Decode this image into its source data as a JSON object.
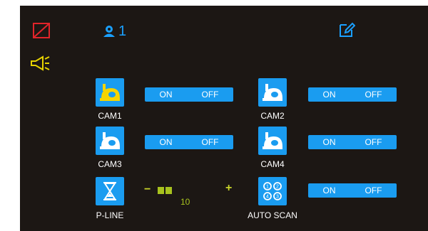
{
  "top": {
    "user_count": "1"
  },
  "cameras": [
    {
      "label": "CAM1",
      "on": "ON",
      "off": "OFF",
      "highlight": true
    },
    {
      "label": "CAM2",
      "on": "ON",
      "off": "OFF",
      "highlight": false
    },
    {
      "label": "CAM3",
      "on": "ON",
      "off": "OFF",
      "highlight": false
    },
    {
      "label": "CAM4",
      "on": "ON",
      "off": "OFF",
      "highlight": false
    }
  ],
  "pline": {
    "label": "P-LINE",
    "minus": "−",
    "plus": "+",
    "level": "10"
  },
  "autoscan": {
    "label": "AUTO SCAN",
    "on": "ON",
    "off": "OFF"
  },
  "colors": {
    "accent": "#1a9cf0",
    "background": "#1c1714",
    "highlight": "#f5d400",
    "warning": "#e0242a"
  }
}
